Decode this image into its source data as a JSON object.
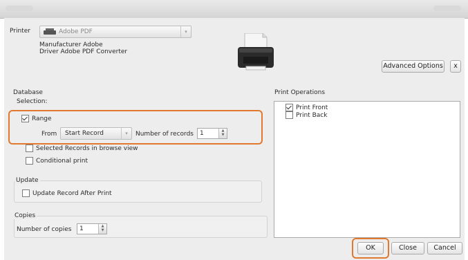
{
  "printer": {
    "label": "Printer",
    "selected": "Adobe PDF",
    "manufacturer_line": "Manufacturer Adobe",
    "driver_line": "Driver Adobe PDF Converter",
    "advanced_button": "Advanced Options",
    "close_x": "x"
  },
  "database": {
    "title": "Database",
    "selection_label": "Selection:",
    "range_label": "Range",
    "range_checked": true,
    "from_label": "From",
    "from_value": "Start Record",
    "number_label": "Number of records",
    "number_value": "1",
    "selected_records_label": "Selected Records in browse view",
    "conditional_label": "Conditional print"
  },
  "update": {
    "title": "Update",
    "checkbox_label": "Update Record After Print"
  },
  "copies": {
    "title": "Copies",
    "label": "Number of copies",
    "value": "1"
  },
  "print_operations": {
    "title": "Print Operations",
    "items": [
      {
        "label": "Print Front",
        "checked": true
      },
      {
        "label": "Print Back",
        "checked": false
      }
    ]
  },
  "footer": {
    "ok": "OK",
    "close": "Close",
    "cancel": "Cancel"
  },
  "colors": {
    "highlight": "#e0782e"
  }
}
